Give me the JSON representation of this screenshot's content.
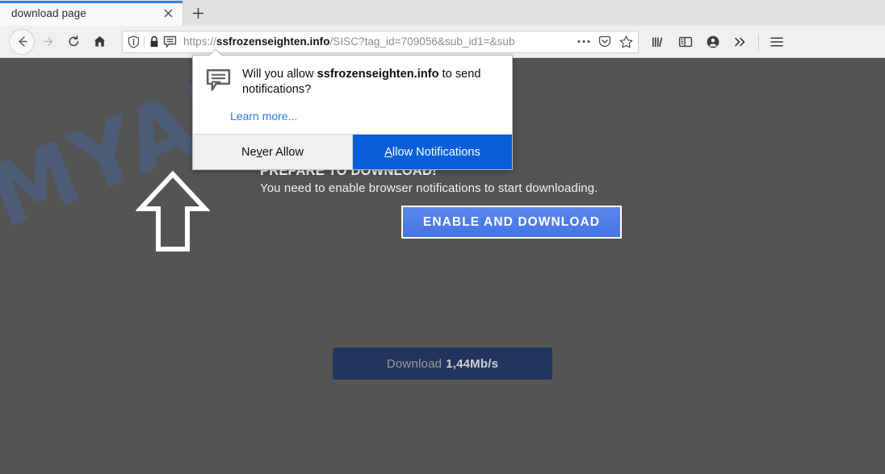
{
  "browser": {
    "tab": {
      "title": "download page",
      "close_icon": "close-icon",
      "newtab_label": "+"
    },
    "nav": {
      "back_icon": "back-arrow-icon",
      "forward_icon": "forward-arrow-icon",
      "reload_icon": "reload-icon",
      "home_icon": "home-icon"
    },
    "urlbar": {
      "shield_icon": "shield-icon",
      "lock_icon": "lock-icon",
      "notification_icon": "notification-bubble-icon",
      "url_prefix": "https://",
      "url_host": "ssfrozenseighten.info",
      "url_path": "/SISC?tag_id=709056&sub_id1=&sub",
      "full_url": "https://ssfrozenseighten.info/SISC?tag_id=709056&sub_id1=&sub",
      "page_actions_icon": "ellipsis-icon",
      "pocket_icon": "pocket-icon",
      "bookmark_icon": "star-icon"
    },
    "toolbar": {
      "library_icon": "library-icon",
      "sidebar_icon": "sidebar-icon",
      "account_icon": "account-icon",
      "overflow_icon": "chevron-double-right-icon",
      "menu_icon": "hamburger-menu-icon"
    }
  },
  "doorhanger": {
    "icon": "notification-bubble-icon",
    "message_pre": "Will you allow ",
    "message_host": "ssfrozenseighten.info",
    "message_post": " to send notifications?",
    "learn_more": "Learn more...",
    "never_allow": {
      "pre": "Ne",
      "key": "v",
      "post": "er Allow"
    },
    "allow": {
      "pre": "",
      "key": "A",
      "post": "llow Notifications"
    }
  },
  "page": {
    "watermark": "MYANTISPYWARE.COM",
    "arrow_icon": "up-arrow-outline-icon",
    "headline": "PREPARE TO DOWNLOAD!",
    "subtext": "You need to enable browser notifications to start downloading.",
    "enable_button": "ENABLE AND DOWNLOAD",
    "download_button_label": "Download",
    "download_button_speed": "1,44Mb/s"
  },
  "colors": {
    "page_bg": "#545454",
    "accent_blue": "#0a5fd8",
    "enable_blue": "#4a7ce8",
    "download_navy": "#23345f",
    "watermark_blue": "#4668aa",
    "tab_accent": "#3a80d8"
  }
}
